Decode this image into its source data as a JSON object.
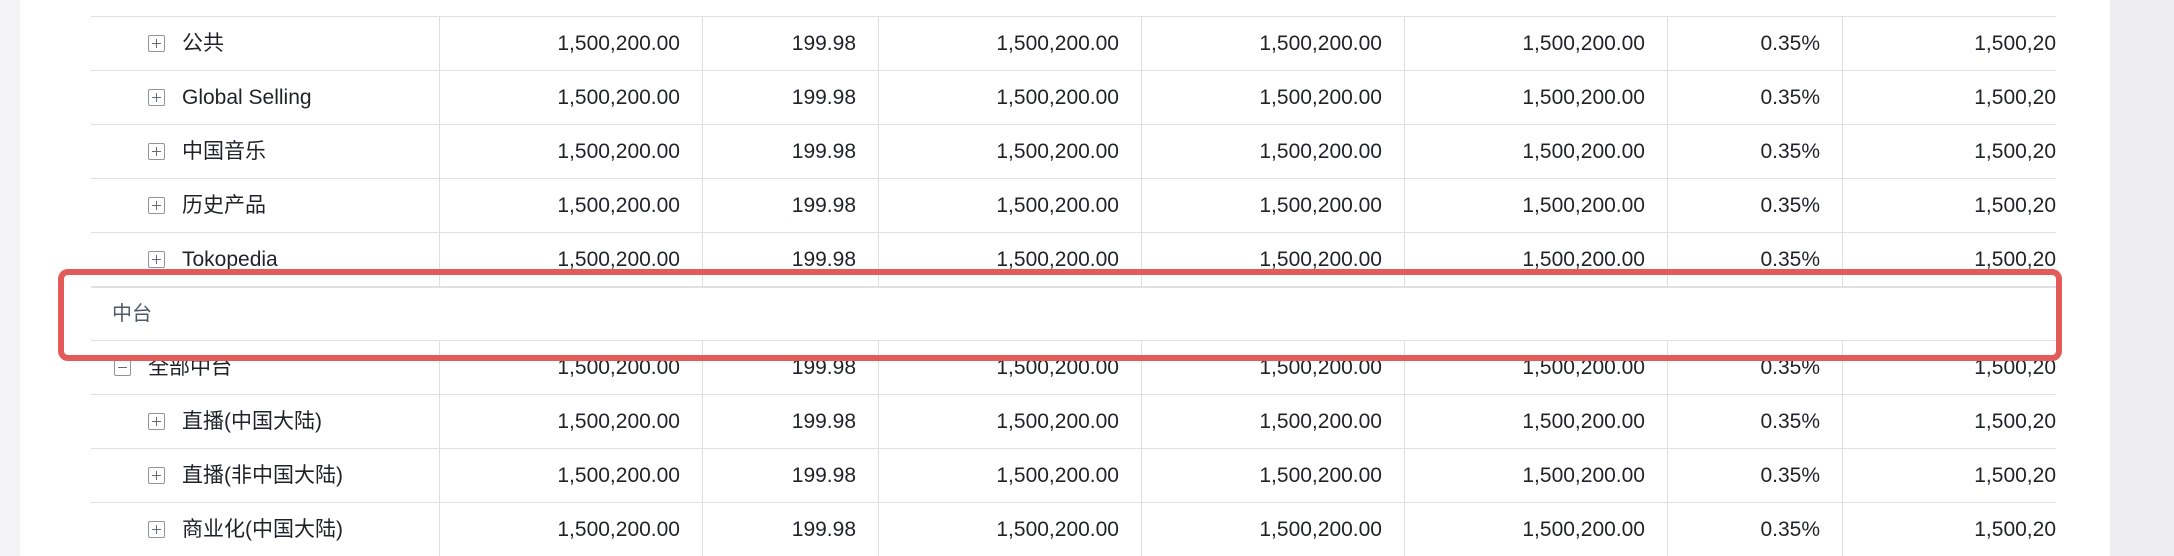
{
  "section": {
    "label": "中台"
  },
  "highlight_color": "#e25b59",
  "rows": [
    {
      "type": "child",
      "name": "公共",
      "values": [
        "1,500,200.00",
        "199.98",
        "1,500,200.00",
        "1,500,200.00",
        "1,500,200.00",
        "0.35%",
        "1,500,20"
      ]
    },
    {
      "type": "child",
      "name": "Global Selling",
      "values": [
        "1,500,200.00",
        "199.98",
        "1,500,200.00",
        "1,500,200.00",
        "1,500,200.00",
        "0.35%",
        "1,500,20"
      ]
    },
    {
      "type": "child",
      "name": "中国音乐",
      "values": [
        "1,500,200.00",
        "199.98",
        "1,500,200.00",
        "1,500,200.00",
        "1,500,200.00",
        "0.35%",
        "1,500,20"
      ]
    },
    {
      "type": "child",
      "name": "历史产品",
      "values": [
        "1,500,200.00",
        "199.98",
        "1,500,200.00",
        "1,500,200.00",
        "1,500,200.00",
        "0.35%",
        "1,500,20"
      ]
    },
    {
      "type": "child",
      "name": "Tokopedia",
      "values": [
        "1,500,200.00",
        "199.98",
        "1,500,200.00",
        "1,500,200.00",
        "1,500,200.00",
        "0.35%",
        "1,500,20"
      ]
    },
    {
      "type": "parent",
      "name": "全部中台",
      "values": [
        "1,500,200.00",
        "199.98",
        "1,500,200.00",
        "1,500,200.00",
        "1,500,200.00",
        "0.35%",
        "1,500,20"
      ]
    },
    {
      "type": "child",
      "name": "直播(中国大陆)",
      "values": [
        "1,500,200.00",
        "199.98",
        "1,500,200.00",
        "1,500,200.00",
        "1,500,200.00",
        "0.35%",
        "1,500,20"
      ]
    },
    {
      "type": "child",
      "name": "直播(非中国大陆)",
      "values": [
        "1,500,200.00",
        "199.98",
        "1,500,200.00",
        "1,500,200.00",
        "1,500,200.00",
        "0.35%",
        "1,500,20"
      ]
    },
    {
      "type": "child",
      "name": "商业化(中国大陆)",
      "values": [
        "1,500,200.00",
        "199.98",
        "1,500,200.00",
        "1,500,200.00",
        "1,500,200.00",
        "0.35%",
        "1,500,20"
      ]
    }
  ]
}
